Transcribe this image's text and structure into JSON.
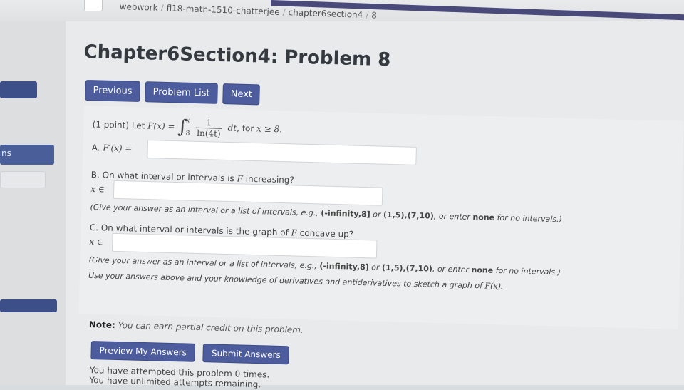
{
  "breadcrumb": {
    "course_root": "webwork",
    "course": "fl18-math-1510-chatterjee",
    "set": "chapter6section4",
    "problem": "8"
  },
  "sidebar": {
    "partial_label": "ns"
  },
  "page_title": "Chapter6Section4: Problem 8",
  "nav": {
    "previous": "Previous",
    "problem_list": "Problem List",
    "next": "Next"
  },
  "problem": {
    "intro_points": "(1 point) Let",
    "F_of_x": "F(x) =",
    "integral_upper": "x",
    "integral_lower": "8",
    "integrand_num": "1",
    "integrand_den": "ln(4t)",
    "dt": "dt",
    "condition_prefix": ", for",
    "condition": "x ≥ 8.",
    "partA_label": "A.",
    "partA_math": "F′(x) =",
    "partB_text": "B. On what interval or intervals is",
    "partB_var": "F",
    "partB_suffix": "increasing?",
    "partB_prefix_math": "x ∈",
    "hint_prefix": "(Give your answer as an interval or a list of intervals, e.g.,",
    "hint_example1": "(-infinity,8]",
    "hint_or": "or",
    "hint_example2": "(1,5),(7,10)",
    "hint_enter": ", or enter",
    "hint_none": "none",
    "hint_suffix": "for no intervals.)",
    "partC_text": "C. On what interval or intervals is the graph of",
    "partC_var": "F",
    "partC_suffix": "concave up?",
    "partC_prefix_math": "x ∈",
    "sketch_text": "Use your answers above and your knowledge of derivatives and antiderivatives to sketch a graph of",
    "sketch_math": "F(x)",
    "sketch_period": "."
  },
  "note": {
    "label": "Note:",
    "text": "You can earn partial credit on this problem."
  },
  "actions": {
    "preview": "Preview My Answers",
    "submit": "Submit Answers"
  },
  "attempts": {
    "line1": "You have attempted this problem 0 times.",
    "line2": "You have unlimited attempts remaining."
  },
  "colors": {
    "button": "#4d5c9c",
    "sidebar_accent": "#3c4f88",
    "background": "#e8eaec"
  }
}
